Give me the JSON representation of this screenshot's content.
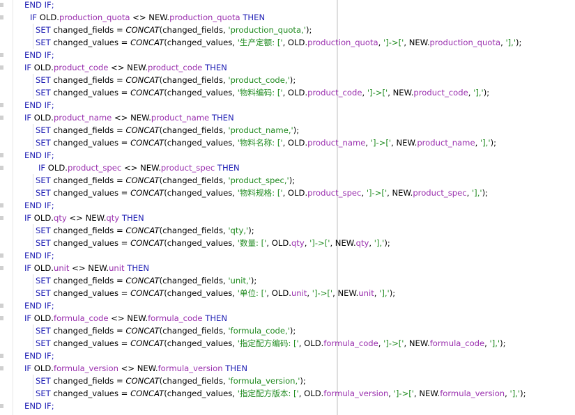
{
  "editor": {
    "lines": [
      [
        [
          "k",
          "END IF;"
        ]
      ],
      [
        [
          "k",
          "IF "
        ],
        [
          "p",
          "OLD."
        ],
        [
          "f",
          "production_quota"
        ],
        [
          "p",
          " <> NEW."
        ],
        [
          "f",
          "production_quota"
        ],
        [
          "k",
          " THEN"
        ]
      ],
      [
        [
          "k",
          "SET "
        ],
        [
          "p",
          "changed_fields = "
        ],
        [
          "c",
          "CONCAT"
        ],
        [
          "p",
          "(changed_fields, "
        ],
        [
          "s",
          "'production_quota,'"
        ],
        [
          "p",
          ");"
        ]
      ],
      [
        [
          "k",
          "SET "
        ],
        [
          "p",
          "changed_values = "
        ],
        [
          "c",
          "CONCAT"
        ],
        [
          "p",
          "(changed_values, "
        ],
        [
          "s",
          "'生产定额: ['"
        ],
        [
          "p",
          ", OLD."
        ],
        [
          "f",
          "production_quota"
        ],
        [
          "p",
          ", "
        ],
        [
          "s",
          "']->['"
        ],
        [
          "p",
          ", NEW."
        ],
        [
          "f",
          "production_quota"
        ],
        [
          "p",
          ", "
        ],
        [
          "s",
          "'],'"
        ],
        [
          "p",
          ");"
        ]
      ],
      [
        [
          "k",
          "END IF;"
        ]
      ],
      [
        [
          "k",
          "IF "
        ],
        [
          "p",
          "OLD."
        ],
        [
          "f",
          "product_code"
        ],
        [
          "p",
          " <> NEW."
        ],
        [
          "f",
          "product_code"
        ],
        [
          "k",
          " THEN"
        ]
      ],
      [
        [
          "k",
          "SET "
        ],
        [
          "p",
          "changed_fields = "
        ],
        [
          "c",
          "CONCAT"
        ],
        [
          "p",
          "(changed_fields, "
        ],
        [
          "s",
          "'product_code,'"
        ],
        [
          "p",
          ");"
        ]
      ],
      [
        [
          "k",
          "SET "
        ],
        [
          "p",
          "changed_values = "
        ],
        [
          "c",
          "CONCAT"
        ],
        [
          "p",
          "(changed_values, "
        ],
        [
          "s",
          "'物料编码: ['"
        ],
        [
          "p",
          ", OLD."
        ],
        [
          "f",
          "product_code"
        ],
        [
          "p",
          ", "
        ],
        [
          "s",
          "']->['"
        ],
        [
          "p",
          ", NEW."
        ],
        [
          "f",
          "product_code"
        ],
        [
          "p",
          ", "
        ],
        [
          "s",
          "'],'"
        ],
        [
          "p",
          ");"
        ]
      ],
      [
        [
          "k",
          "END IF;"
        ]
      ],
      [
        [
          "k",
          "IF "
        ],
        [
          "p",
          "OLD."
        ],
        [
          "f",
          "product_name"
        ],
        [
          "p",
          " <> NEW."
        ],
        [
          "f",
          "product_name"
        ],
        [
          "k",
          " THEN"
        ]
      ],
      [
        [
          "k",
          "SET "
        ],
        [
          "p",
          "changed_fields = "
        ],
        [
          "c",
          "CONCAT"
        ],
        [
          "p",
          "(changed_fields, "
        ],
        [
          "s",
          "'product_name,'"
        ],
        [
          "p",
          ");"
        ]
      ],
      [
        [
          "k",
          "SET "
        ],
        [
          "p",
          "changed_values = "
        ],
        [
          "c",
          "CONCAT"
        ],
        [
          "p",
          "(changed_values, "
        ],
        [
          "s",
          "'物料名称: ['"
        ],
        [
          "p",
          ", OLD."
        ],
        [
          "f",
          "product_name"
        ],
        [
          "p",
          ", "
        ],
        [
          "s",
          "']->['"
        ],
        [
          "p",
          ", NEW."
        ],
        [
          "f",
          "product_name"
        ],
        [
          "p",
          ", "
        ],
        [
          "s",
          "'],'"
        ],
        [
          "p",
          ");"
        ]
      ],
      [
        [
          "k",
          "END IF;"
        ]
      ],
      [
        [
          "k",
          "IF "
        ],
        [
          "p",
          "OLD."
        ],
        [
          "f",
          "product_spec"
        ],
        [
          "p",
          " <> NEW."
        ],
        [
          "f",
          "product_spec"
        ],
        [
          "k",
          " THEN"
        ]
      ],
      [
        [
          "k",
          "SET "
        ],
        [
          "p",
          "changed_fields = "
        ],
        [
          "c",
          "CONCAT"
        ],
        [
          "p",
          "(changed_fields, "
        ],
        [
          "s",
          "'product_spec,'"
        ],
        [
          "p",
          ");"
        ]
      ],
      [
        [
          "k",
          "SET "
        ],
        [
          "p",
          "changed_values = "
        ],
        [
          "c",
          "CONCAT"
        ],
        [
          "p",
          "(changed_values, "
        ],
        [
          "s",
          "'物料规格: ['"
        ],
        [
          "p",
          ", OLD."
        ],
        [
          "f",
          "product_spec"
        ],
        [
          "p",
          ", "
        ],
        [
          "s",
          "']->['"
        ],
        [
          "p",
          ", NEW."
        ],
        [
          "f",
          "product_spec"
        ],
        [
          "p",
          ", "
        ],
        [
          "s",
          "'],'"
        ],
        [
          "p",
          ");"
        ]
      ],
      [
        [
          "k",
          "END IF;"
        ]
      ],
      [
        [
          "k",
          "IF "
        ],
        [
          "p",
          "OLD."
        ],
        [
          "f",
          "qty"
        ],
        [
          "p",
          " <> NEW."
        ],
        [
          "f",
          "qty"
        ],
        [
          "k",
          " THEN"
        ]
      ],
      [
        [
          "k",
          "SET "
        ],
        [
          "p",
          "changed_fields = "
        ],
        [
          "c",
          "CONCAT"
        ],
        [
          "p",
          "(changed_fields, "
        ],
        [
          "s",
          "'qty,'"
        ],
        [
          "p",
          ");"
        ]
      ],
      [
        [
          "k",
          "SET "
        ],
        [
          "p",
          "changed_values = "
        ],
        [
          "c",
          "CONCAT"
        ],
        [
          "p",
          "(changed_values, "
        ],
        [
          "s",
          "'数量: ['"
        ],
        [
          "p",
          ", OLD."
        ],
        [
          "f",
          "qty"
        ],
        [
          "p",
          ", "
        ],
        [
          "s",
          "']->['"
        ],
        [
          "p",
          ", NEW."
        ],
        [
          "f",
          "qty"
        ],
        [
          "p",
          ", "
        ],
        [
          "s",
          "'],'"
        ],
        [
          "p",
          ");"
        ]
      ],
      [
        [
          "k",
          "END IF;"
        ]
      ],
      [
        [
          "k",
          "IF "
        ],
        [
          "p",
          "OLD."
        ],
        [
          "f",
          "unit"
        ],
        [
          "p",
          " <> NEW."
        ],
        [
          "f",
          "unit"
        ],
        [
          "k",
          " THEN"
        ]
      ],
      [
        [
          "k",
          "SET "
        ],
        [
          "p",
          "changed_fields = "
        ],
        [
          "c",
          "CONCAT"
        ],
        [
          "p",
          "(changed_fields, "
        ],
        [
          "s",
          "'unit,'"
        ],
        [
          "p",
          ");"
        ]
      ],
      [
        [
          "k",
          "SET "
        ],
        [
          "p",
          "changed_values = "
        ],
        [
          "c",
          "CONCAT"
        ],
        [
          "p",
          "(changed_values, "
        ],
        [
          "s",
          "'单位: ['"
        ],
        [
          "p",
          ", OLD."
        ],
        [
          "f",
          "unit"
        ],
        [
          "p",
          ", "
        ],
        [
          "s",
          "']->['"
        ],
        [
          "p",
          ", NEW."
        ],
        [
          "f",
          "unit"
        ],
        [
          "p",
          ", "
        ],
        [
          "s",
          "'],'"
        ],
        [
          "p",
          ");"
        ]
      ],
      [
        [
          "k",
          "END IF;"
        ]
      ],
      [
        [
          "k",
          "IF "
        ],
        [
          "p",
          "OLD."
        ],
        [
          "f",
          "formula_code"
        ],
        [
          "p",
          " <> NEW."
        ],
        [
          "f",
          "formula_code"
        ],
        [
          "k",
          " THEN"
        ]
      ],
      [
        [
          "k",
          "SET "
        ],
        [
          "p",
          "changed_fields = "
        ],
        [
          "c",
          "CONCAT"
        ],
        [
          "p",
          "(changed_fields, "
        ],
        [
          "s",
          "'formula_code,'"
        ],
        [
          "p",
          ");"
        ]
      ],
      [
        [
          "k",
          "SET "
        ],
        [
          "p",
          "changed_values = "
        ],
        [
          "c",
          "CONCAT"
        ],
        [
          "p",
          "(changed_values, "
        ],
        [
          "s",
          "'指定配方编码: ['"
        ],
        [
          "p",
          ", OLD."
        ],
        [
          "f",
          "formula_code"
        ],
        [
          "p",
          ", "
        ],
        [
          "s",
          "']->['"
        ],
        [
          "p",
          ", NEW."
        ],
        [
          "f",
          "formula_code"
        ],
        [
          "p",
          ", "
        ],
        [
          "s",
          "'],'"
        ],
        [
          "p",
          ");"
        ]
      ],
      [
        [
          "k",
          "END IF;"
        ]
      ],
      [
        [
          "k",
          "IF "
        ],
        [
          "p",
          "OLD."
        ],
        [
          "f",
          "formula_version"
        ],
        [
          "p",
          " <> NEW."
        ],
        [
          "f",
          "formula_version"
        ],
        [
          "k",
          " THEN"
        ]
      ],
      [
        [
          "k",
          "SET "
        ],
        [
          "p",
          "changed_fields = "
        ],
        [
          "c",
          "CONCAT"
        ],
        [
          "p",
          "(changed_fields, "
        ],
        [
          "s",
          "'formula_version,'"
        ],
        [
          "p",
          ");"
        ]
      ],
      [
        [
          "k",
          "SET "
        ],
        [
          "p",
          "changed_values = "
        ],
        [
          "c",
          "CONCAT"
        ],
        [
          "p",
          "(changed_values, "
        ],
        [
          "s",
          "'指定配方版本: ['"
        ],
        [
          "p",
          ", OLD."
        ],
        [
          "f",
          "formula_version"
        ],
        [
          "p",
          ", "
        ],
        [
          "s",
          "']->['"
        ],
        [
          "p",
          ", NEW."
        ],
        [
          "f",
          "formula_version"
        ],
        [
          "p",
          ", "
        ],
        [
          "s",
          "'],'"
        ],
        [
          "p",
          ");"
        ]
      ],
      [
        [
          "k",
          "END IF;"
        ]
      ]
    ]
  },
  "colors": {
    "keyword": "#1e1eb4",
    "field": "#9a2fae",
    "string": "#1f8a1f"
  }
}
